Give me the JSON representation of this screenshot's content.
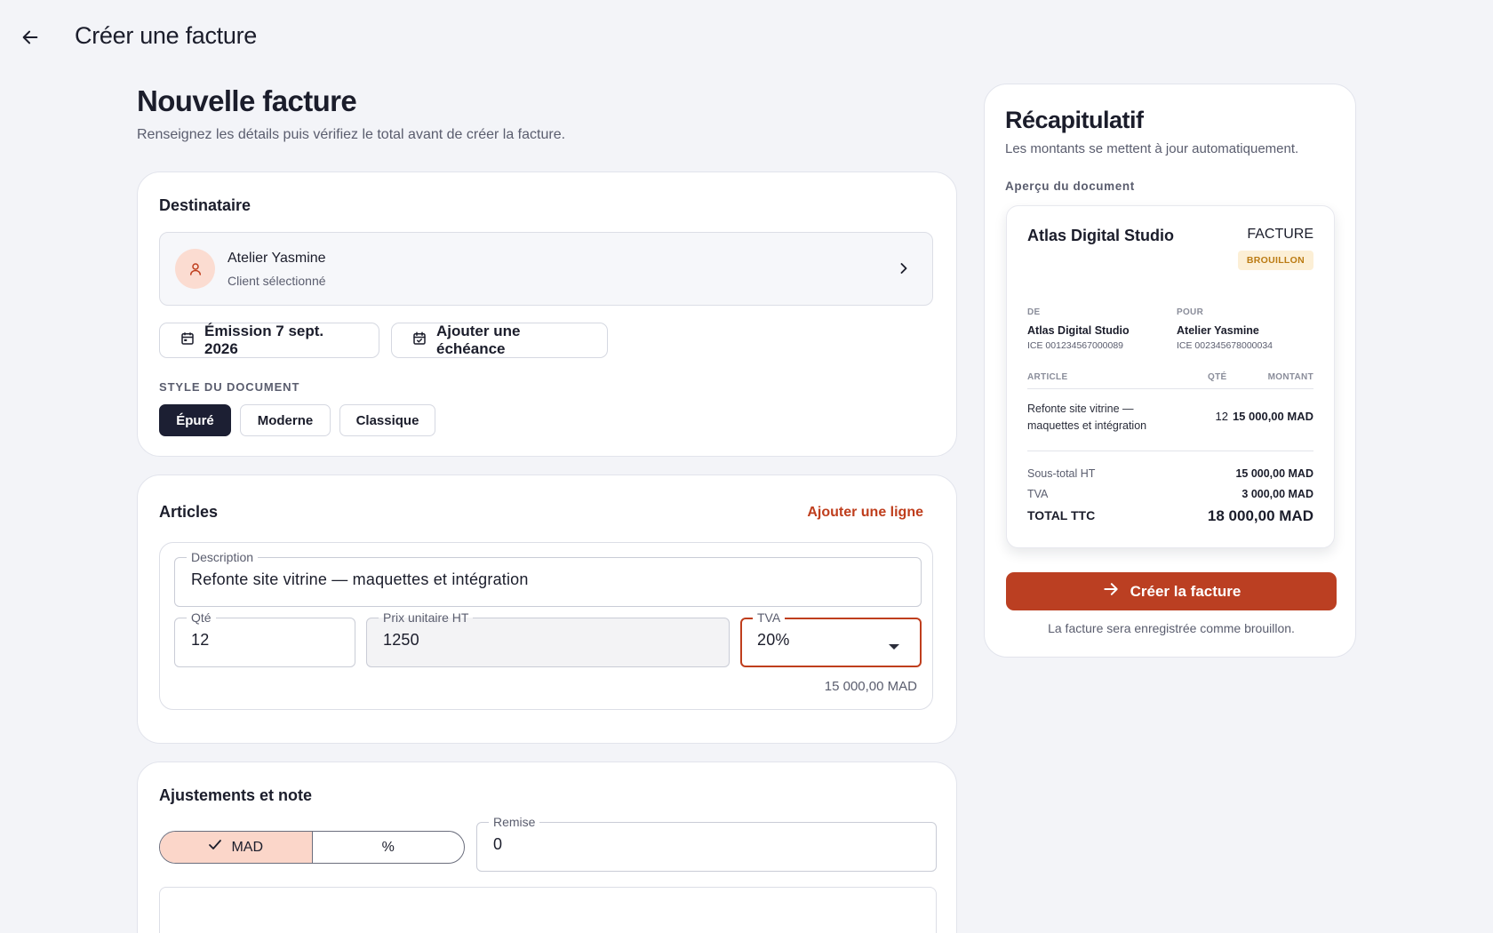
{
  "topbar": {
    "title": "Créer une facture"
  },
  "form": {
    "title": "Nouvelle facture",
    "subtitle": "Renseignez les détails puis vérifiez le total avant de créer la facture.",
    "recipient": {
      "title": "Destinataire",
      "client_name": "Atelier Yasmine",
      "client_status": "Client sélectionné",
      "issue_date": "Émission 7 sept. 2026",
      "add_due_date": "Ajouter une échéance",
      "style_label": "STYLE DU DOCUMENT",
      "styles": [
        "Épuré",
        "Moderne",
        "Classique"
      ],
      "selected_style": "Épuré"
    },
    "articles": {
      "title": "Articles",
      "add_line": "Ajouter une ligne",
      "item": {
        "description_label": "Description",
        "description": "Refonte site vitrine — maquettes et intégration",
        "qty_label": "Qté",
        "qty": "12",
        "unit_price_label": "Prix unitaire HT",
        "unit_price": "1250",
        "vat_label": "TVA",
        "vat": "20%",
        "line_total": "15 000,00 MAD"
      }
    },
    "adjustments": {
      "title": "Ajustements et note",
      "mode_options": [
        "MAD",
        "%"
      ],
      "selected_mode": "MAD",
      "discount_label": "Remise",
      "discount": "0"
    }
  },
  "summary": {
    "title": "Récapitulatif",
    "subtitle": "Les montants se mettent à jour automatiquement.",
    "preview_label": "Aperçu du document",
    "preview": {
      "company": "Atlas Digital Studio",
      "doc_type": "FACTURE",
      "status": "BROUILLON",
      "from_label": "DE",
      "from_name": "Atlas Digital Studio",
      "from_ice": "ICE 001234567000089",
      "to_label": "POUR",
      "to_name": "Atelier Yasmine",
      "to_ice": "ICE 002345678000034",
      "col_article": "ARTICLE",
      "col_qty": "QTÉ",
      "col_amount": "MONTANT",
      "line_desc": "Refonte site vitrine — maquettes et intégration",
      "line_qty": "12",
      "line_amount": "15 000,00 MAD",
      "subtotal_label": "Sous-total HT",
      "subtotal": "15 000,00 MAD",
      "vat_label": "TVA",
      "vat": "3 000,00 MAD",
      "total_label": "TOTAL TTC",
      "total": "18 000,00 MAD"
    },
    "create_button": "Créer la facture",
    "note": "La facture sera enregistrée comme brouillon."
  },
  "colors": {
    "accent": "#bb3f22",
    "dark": "#1c1f33",
    "badge": "#fcefd6",
    "avatar_bg": "#fbd6c9"
  }
}
